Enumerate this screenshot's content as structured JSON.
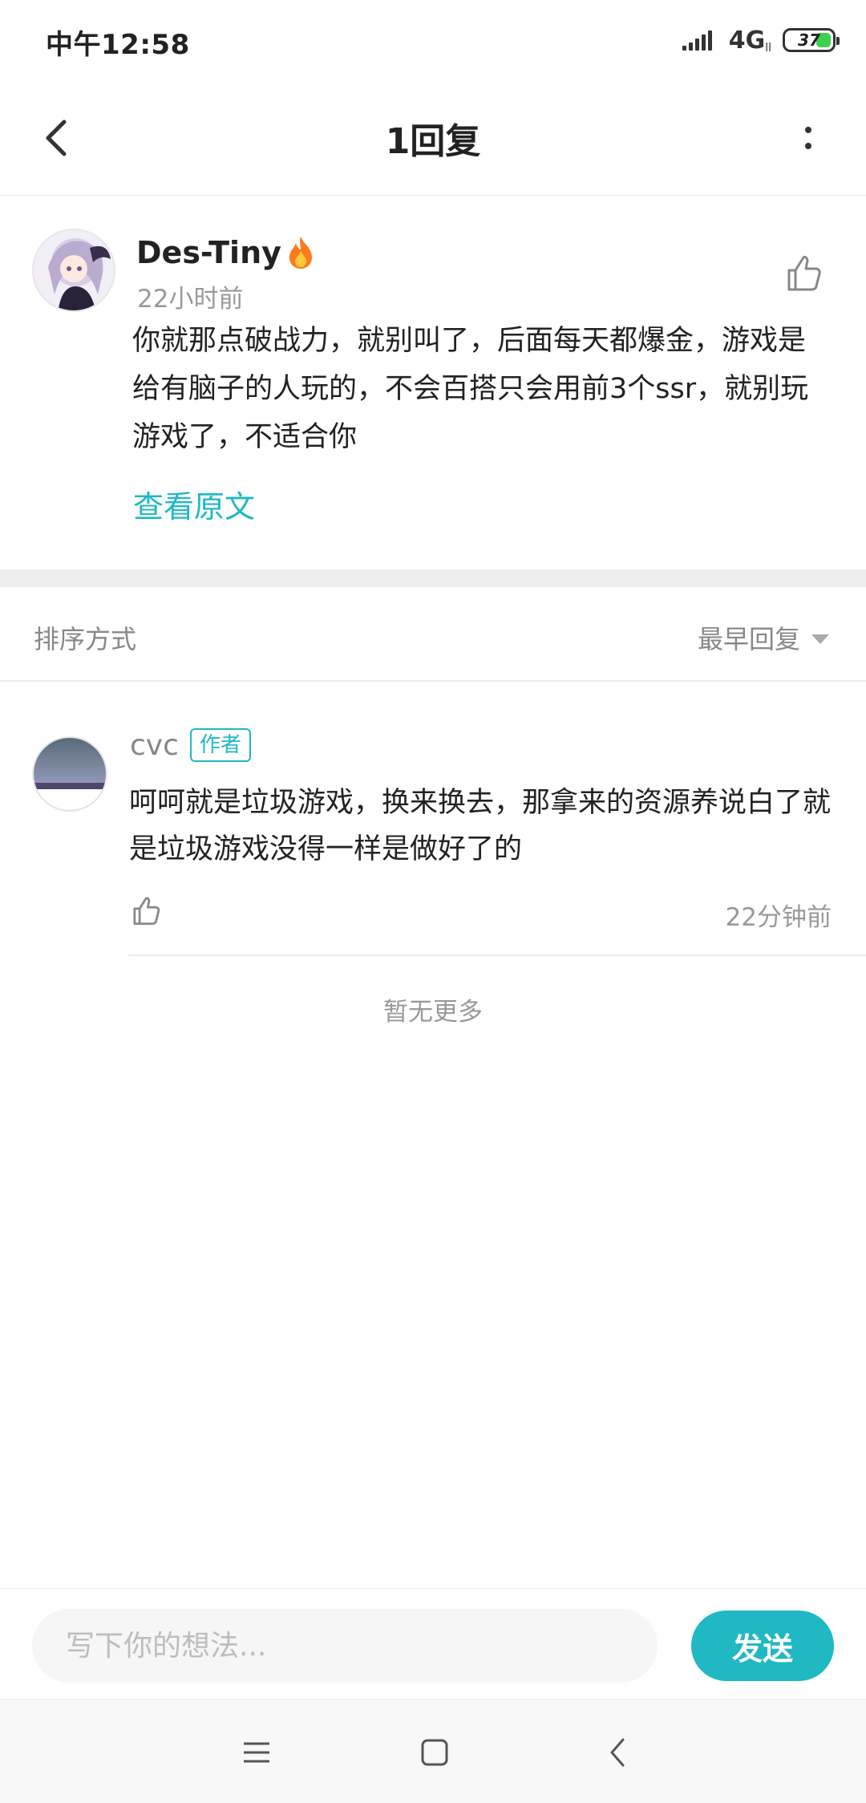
{
  "status_bar": {
    "time": "中午12:58",
    "network": "4G",
    "network_sub": "ll",
    "battery": "37"
  },
  "header": {
    "title": "1回复",
    "back_icon": "chevron-left-icon",
    "more_icon": "more-vertical-icon"
  },
  "post": {
    "username": "Des-Tiny",
    "badge_icon": "fire-icon",
    "time": "22小时前",
    "text": "你就那点破战力，就别叫了，后面每天都爆金，游戏是给有脑子的人玩的，不会百搭只会用前3个ssr，就别玩游戏了，不适合你",
    "view_original": "查看原文",
    "like_icon": "thumbs-up-icon"
  },
  "sort": {
    "label": "排序方式",
    "selected": "最早回复"
  },
  "replies": [
    {
      "username": "cvc",
      "badge": "作者",
      "text": "呵呵就是垃圾游戏，换来换去，那拿来的资源养说白了就是垃圾游戏没得一样是做好了的",
      "time": "22分钟前"
    }
  ],
  "footer_note": "暂无更多",
  "compose": {
    "placeholder": "写下你的想法...",
    "send_label": "发送"
  },
  "colors": {
    "accent": "#1fb8c3",
    "muted_text": "#999999",
    "divider": "#eeeeee"
  }
}
